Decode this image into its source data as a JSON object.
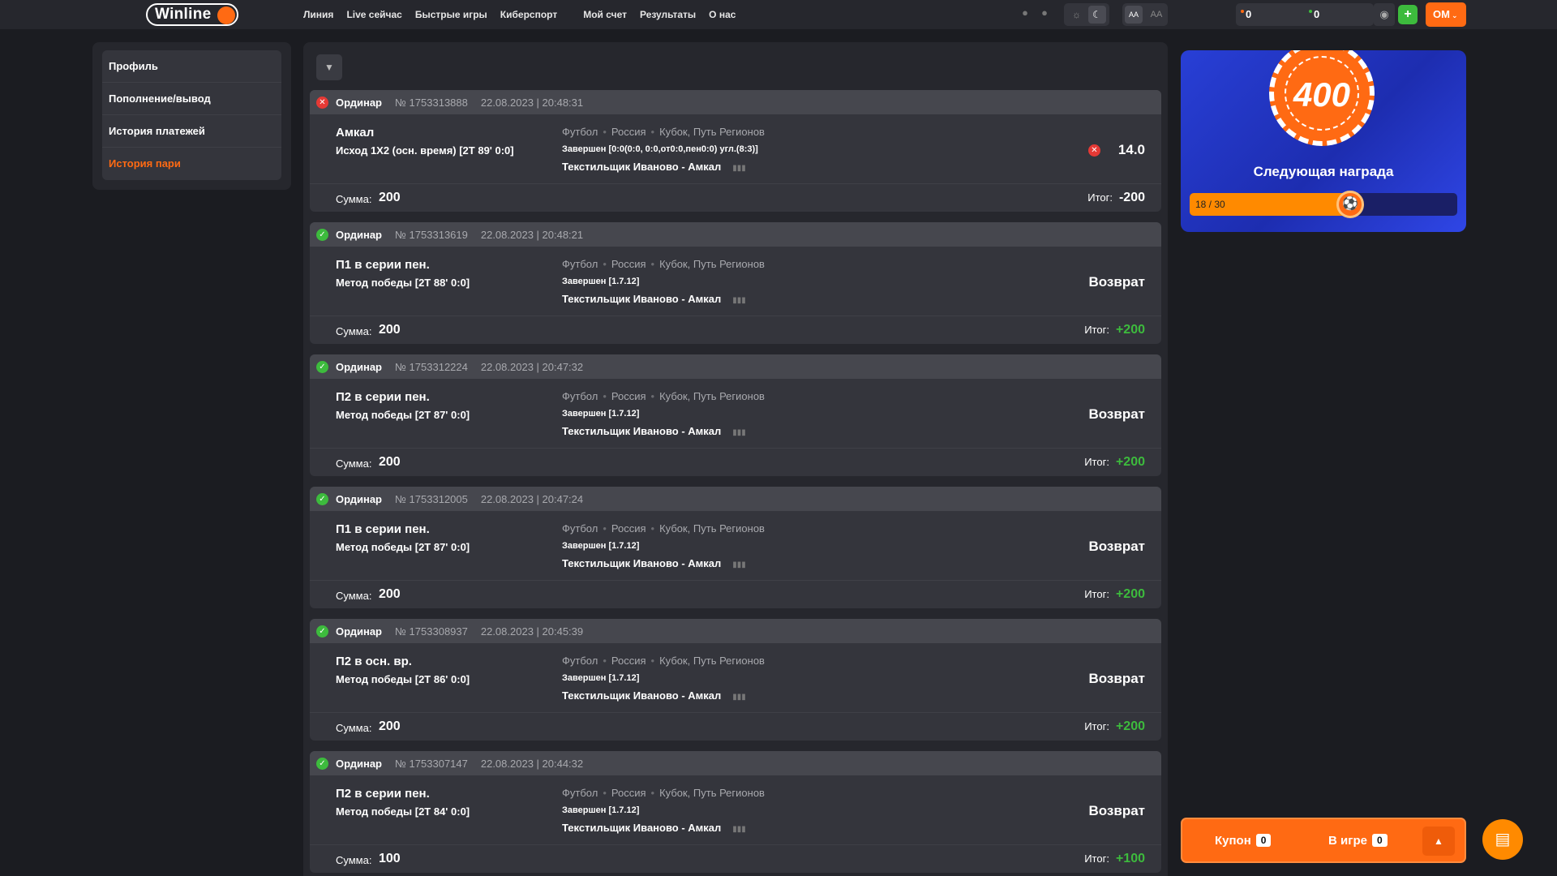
{
  "header": {
    "logo": "Winline",
    "nav": [
      "Линия",
      "Live сейчас",
      "Быстрые игры",
      "Киберспорт"
    ],
    "nav2": [
      "Мой счет",
      "Результаты",
      "О нас"
    ],
    "balance_1": "0",
    "balance_2": "0",
    "font_small": "AA",
    "font_large": "AA",
    "user_initials": "OM",
    "icons": [
      "android-icon",
      "apple-icon",
      "sun-icon",
      "moon-icon",
      "eye-icon",
      "plus-icon",
      "chevron-down-icon"
    ],
    "colors": {
      "accent": "#ff6a13",
      "win": "#3dbb3d",
      "lose": "#e53935"
    }
  },
  "sidebar": {
    "items": [
      {
        "label": "Профиль"
      },
      {
        "label": "Пополнение/вывод"
      },
      {
        "label": "История платежей"
      },
      {
        "label": "История пари"
      }
    ]
  },
  "labels": {
    "sum": "Сумма:",
    "result": "Итог:"
  },
  "bets": [
    {
      "status": "lose",
      "type": "Ординар",
      "number": "№ 1753313888",
      "datetime": "22.08.2023 | 20:48:31",
      "title": "Амкал",
      "subtitle": "Исход 1Х2 (осн. время) [2Т 89' 0:0]",
      "sport": "Футбол",
      "country": "Россия",
      "league": "Кубок, Путь Регионов",
      "event_status": "Завершен [0:0(0:0, 0:0,от0:0,пен0:0) угл.(8:3)]",
      "teams": "Текстильщик Иваново - Амкал",
      "outcome": "14.0",
      "sum": "200",
      "result": "-200"
    },
    {
      "status": "win",
      "type": "Ординар",
      "number": "№ 1753313619",
      "datetime": "22.08.2023 | 20:48:21",
      "title": "П1 в серии пен.",
      "subtitle": "Метод победы [2Т 88' 0:0]",
      "sport": "Футбол",
      "country": "Россия",
      "league": "Кубок, Путь Регионов",
      "event_status": "Завершен [1.7.12]",
      "teams": "Текстильщик Иваново - Амкал",
      "outcome": "Возврат",
      "sum": "200",
      "result": "+200"
    },
    {
      "status": "win",
      "type": "Ординар",
      "number": "№ 1753312224",
      "datetime": "22.08.2023 | 20:47:32",
      "title": "П2 в серии пен.",
      "subtitle": "Метод победы [2Т 87' 0:0]",
      "sport": "Футбол",
      "country": "Россия",
      "league": "Кубок, Путь Регионов",
      "event_status": "Завершен [1.7.12]",
      "teams": "Текстильщик Иваново - Амкал",
      "outcome": "Возврат",
      "sum": "200",
      "result": "+200"
    },
    {
      "status": "win",
      "type": "Ординар",
      "number": "№ 1753312005",
      "datetime": "22.08.2023 | 20:47:24",
      "title": "П1 в серии пен.",
      "subtitle": "Метод победы [2Т 87' 0:0]",
      "sport": "Футбол",
      "country": "Россия",
      "league": "Кубок, Путь Регионов",
      "event_status": "Завершен [1.7.12]",
      "teams": "Текстильщик Иваново - Амкал",
      "outcome": "Возврат",
      "sum": "200",
      "result": "+200"
    },
    {
      "status": "win",
      "type": "Ординар",
      "number": "№ 1753308937",
      "datetime": "22.08.2023 | 20:45:39",
      "title": "П2 в осн. вр.",
      "subtitle": "Метод победы [2Т 86' 0:0]",
      "sport": "Футбол",
      "country": "Россия",
      "league": "Кубок, Путь Регионов",
      "event_status": "Завершен [1.7.12]",
      "teams": "Текстильщик Иваново - Амкал",
      "outcome": "Возврат",
      "sum": "200",
      "result": "+200"
    },
    {
      "status": "win",
      "type": "Ординар",
      "number": "№ 1753307147",
      "datetime": "22.08.2023 | 20:44:32",
      "title": "П2 в серии пен.",
      "subtitle": "Метод победы [2Т 84' 0:0]",
      "sport": "Футбол",
      "country": "Россия",
      "league": "Кубок, Путь Регионов",
      "event_status": "Завершен [1.7.12]",
      "teams": "Текстильщик Иваново - Амкал",
      "outcome": "Возврат",
      "sum": "100",
      "result": "+100"
    }
  ],
  "reward": {
    "chip_value": "400",
    "title": "Следующая награда",
    "progress_text": "18 / 30",
    "progress_fraction": 0.6
  },
  "coupon": {
    "coupon_label": "Купон",
    "coupon_count": "0",
    "ingame_label": "В игре",
    "ingame_count": "0"
  }
}
